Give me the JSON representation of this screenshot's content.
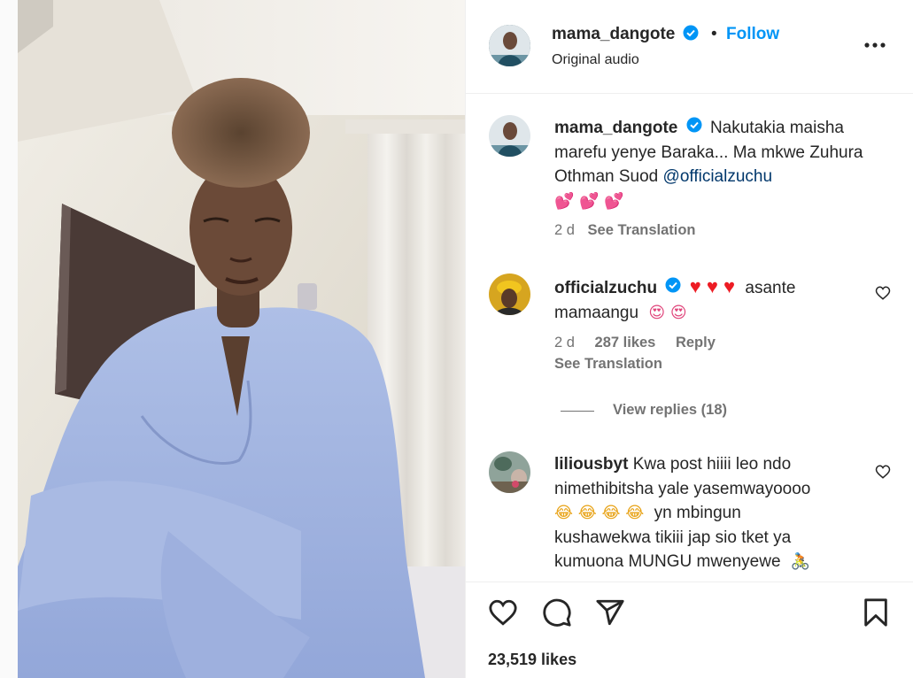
{
  "header": {
    "username": "mama_dangote",
    "separator": "•",
    "follow_label": "Follow",
    "subtitle": "Original audio"
  },
  "caption": {
    "username": "mama_dangote",
    "text": "Nakutakia maisha marefu yenye Baraka... Ma mkwe Zuhura Othman Suod",
    "mention": "@officialzuchu",
    "emojis": "💕 💕 💕",
    "time": "2 d",
    "translation": "See Translation"
  },
  "comments": [
    {
      "username": "officialzuchu",
      "hearts": "♥ ♥ ♥",
      "text_a": "asante",
      "text_b": "mamaangu",
      "emojis": "😍 😍",
      "time": "2 d",
      "likes": "287 likes",
      "reply": "Reply",
      "translation": "See Translation",
      "view_replies": "View replies (18)"
    },
    {
      "username": "liliousbyt",
      "line1": "Kwa post hiiii leo ndo",
      "line2": "nimethibitsha yale yasemwayoooo",
      "line3_emoji": "😂 😂 😂 😂",
      "line3_text": "yn mbingun",
      "line4": "kushawekwa tikiii jap sio tket ya",
      "line5": "kumuona MUNGU mwenyewe",
      "line5_emoji": "🚴"
    }
  ],
  "footer": {
    "likes": "23,519 likes"
  },
  "icons": {
    "like": "heart-outline-icon",
    "comment": "speech-bubble-icon",
    "share": "paper-plane-icon",
    "save": "bookmark-icon",
    "more": "more-dots-icon",
    "verified": "verified-badge-icon"
  },
  "colors": {
    "accent": "#0095f6",
    "verified": "#0095f6",
    "heart_red": "#ed1c24",
    "mention": "#00376b"
  }
}
